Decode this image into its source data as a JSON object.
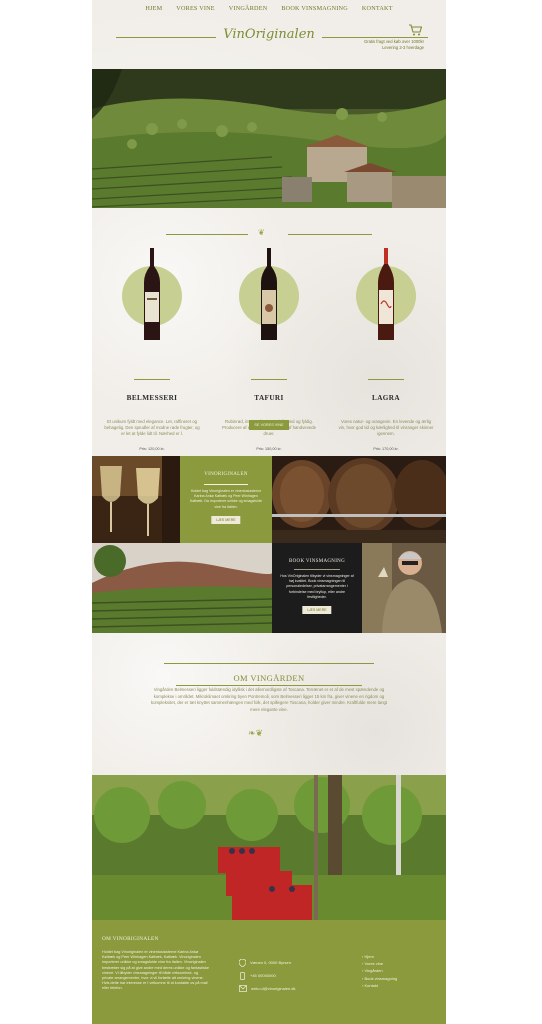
{
  "nav": {
    "items": [
      "HJEM",
      "VORES VINE",
      "VINGÅRDEN",
      "BOOK VINSMAGNING",
      "KONTAKT"
    ]
  },
  "header": {
    "logo": "VinOriginalen",
    "shipping_line1": "Gratis fragt ved køb over 1000kr",
    "shipping_line2": "Levering 2-3 hverdage"
  },
  "wines": [
    {
      "name": "BELMESSERI",
      "description": "Et unikum fyldt med elegance. Let, raffineret og behagelig. Den sprudler af modne røde frugter, og er let at fylde lidt til. Nærhed er l.",
      "price": "Pris: 120,00 kr.",
      "label_color": "#e9e3d2",
      "glass_color": "#2a1414"
    },
    {
      "name": "TAFURI",
      "description": "Rubinrød, intense farve - stabilt rund og fyldig. Producere af et uimponeret luftige af handvevede druer.",
      "price": "Pris: 150,00 kr.",
      "label_color": "#d8c8a8",
      "glass_color": "#1e1210"
    },
    {
      "name": "LAGRA",
      "description": "Vores natur- og orangevin. En levende og ærlig vin, hvor god tid og kærlighed til vinranger skinner igennem.",
      "price": "Pris: 170,00 kr.",
      "label_color": "#f0e6d8",
      "glass_color": "#6a1a10"
    }
  ],
  "see_wines_button": "SE VORES VINE",
  "tiles": {
    "vinoriginalen": {
      "title": "VINORIGINALEN",
      "body": "Holdet bag Vinoriginalen er vinentusiasterne Karina Ankø Kølbæk og Peer Winhagen Kølbæk. Da importerer unikke og smagsfulde vine fra Italien.",
      "button": "LÆS MERE"
    },
    "book": {
      "title": "BOOK VINSMAGNING",
      "body": "Hos VinOriginalen tilbyder vi vinsmagninger af høj kvalitet. Book vinsmagningen til personaledelser, privatarrangementer i forbindelse med bryllup, eller andre festligheder.",
      "button": "LÆS MERE"
    }
  },
  "about": {
    "title": "OM VINGÅRDEN",
    "body": "Vingården Belmesseri ligger fuldstændig idyllisk i det allernordligste af Toscana. Terrænet er et af de mest spændende og komplekse i området. Mikroklimaet omkring byen Pontremoli, som Belmesseri ligger 15 km fra, giver vinene en rigdom og kompleksitet, der er tæt knyttet sammenhængen med folk, det spillegere Toscana, holder giver mindre. Kraftfulde mere langt mere elegante vine."
  },
  "footer": {
    "title": "OM VINORIGINALEN",
    "body": "Holdet bag Vinoriginalen er vinentusiasterne Karina Ankø Kølbæk og Peer Winhagen Kølbæk, Kølbæk. Vinoriginalen importerer unikke og smagsfulde vine fra Italien. Vinoriginalen bestræber sig på at give andre med deres unikke og fantastiske vinene. Vi tilbyder vinsmagninger til både virksomhed- og private arrangementer, hvor vi vil fortælle alt omkring vinene. Hvis dette har interesse er I velkomne til at kontakte os på mail eller telefon.",
    "address": "Vænen 0, 0000 Byrsen",
    "phone": "+45 00000000",
    "email": "writu.ul@vinoriginalen.dk",
    "links": [
      "Hjem",
      "Vores vine",
      "Vingården",
      "Book vinsmagning",
      "Kontakt"
    ]
  }
}
